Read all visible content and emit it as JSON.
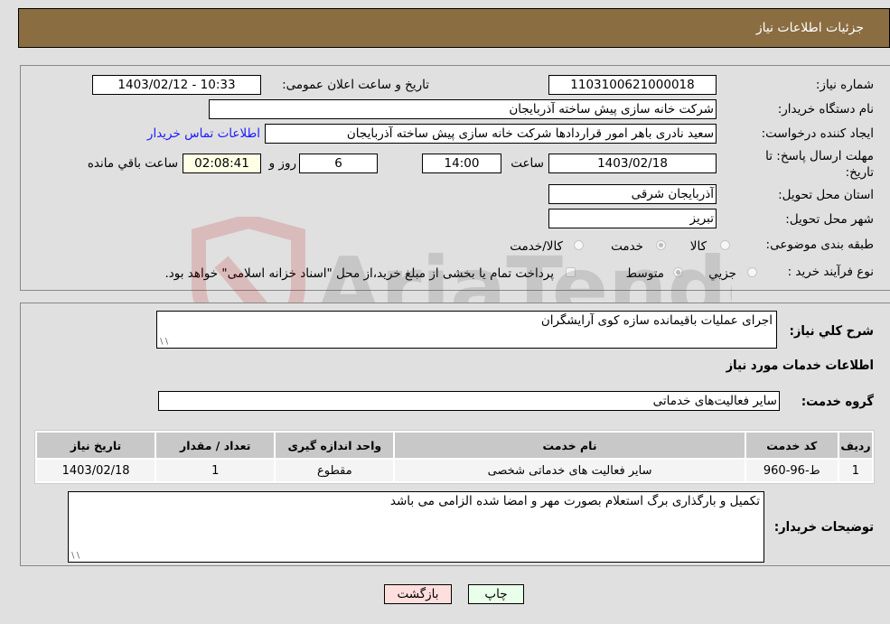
{
  "header": {
    "title": "جزئیات اطلاعات نیاز"
  },
  "details": {
    "need_number_label": "شماره نیاز:",
    "need_number": "1103100621000018",
    "announce_label": "تاریخ و ساعت اعلان عمومی:",
    "announce_value": "1403/02/12 - 10:33",
    "buyer_org_label": "نام دستگاه خریدار:",
    "buyer_org": "شرکت خانه سازی پیش ساخته آذربایجان",
    "requester_label": "ایجاد کننده درخواست:",
    "requester": "سعید نادری باهر امور قراردادها شرکت خانه سازی پیش ساخته آذربایجان",
    "contact_link": "اطلاعات تماس خریدار",
    "deadline_label_1": "مهلت ارسال پاسخ: تا",
    "deadline_label_2": "تاریخ:",
    "deadline_date": "1403/02/18",
    "time_label": "ساعت",
    "deadline_time": "14:00",
    "days_value": "6",
    "days_label": "روز و",
    "remaining_time": "02:08:41",
    "remaining_label": "ساعت باقي مانده",
    "province_label": "استان محل تحویل:",
    "province": "آذربایجان شرقی",
    "city_label": "شهر محل تحویل:",
    "city": "تبریز",
    "category_label": "طبقه بندی موضوعی:",
    "category_options": [
      "کالا",
      "خدمت",
      "کالا/خدمت"
    ],
    "category_selected": "خدمت",
    "process_label": "نوع فرآیند خرید :",
    "process_options": [
      "جزیي",
      "متوسط"
    ],
    "process_selected": "متوسط",
    "treasury_note": "پرداخت تمام یا بخشی از مبلغ خرید،از محل \"اسناد خزانه اسلامی\" خواهد بود."
  },
  "summary": {
    "description_label": "شرح کلي نیاز:",
    "description": "اجرای عملیات باقیمانده سازه کوی آرایشگران",
    "services_heading": "اطلاعات خدمات مورد نیاز",
    "service_group_label": "گروه خدمت:",
    "service_group": "سایر فعالیت‌های خدماتی"
  },
  "table": {
    "headers": [
      "ردیف",
      "کد خدمت",
      "نام خدمت",
      "واحد اندازه گیری",
      "تعداد / مقدار",
      "تاریخ نیاز"
    ],
    "rows": [
      [
        "1",
        "ط-96-960",
        "سایر فعالیت های خدماتی شخصی",
        "مقطوع",
        "1",
        "1403/02/18"
      ]
    ]
  },
  "buyer_notes": {
    "label": "توضیحات خریدار:",
    "text": "تکمیل و بارگذاری برگ استعلام بصورت مهر و امضا شده الزامی می باشد"
  },
  "buttons": {
    "print": "چاپ",
    "back": "بازگشت"
  },
  "watermark": {
    "text": "AriaTender.neT"
  }
}
